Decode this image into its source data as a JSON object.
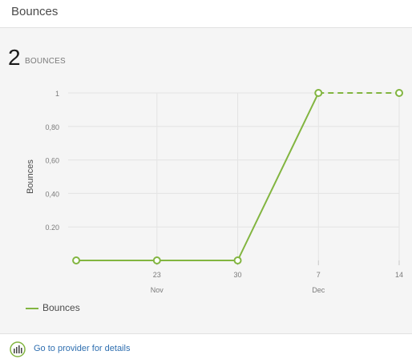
{
  "header": {
    "title": "Bounces"
  },
  "summary": {
    "value": "2",
    "label": "BOUNCES"
  },
  "chart_data": {
    "type": "line",
    "ylabel": "Bounces",
    "y_ticks": [
      "0.20",
      "0,40",
      "0,60",
      "0,80",
      "1"
    ],
    "y_tick_values": [
      0.2,
      0.4,
      0.6,
      0.8,
      1.0
    ],
    "ylim": [
      0,
      1
    ],
    "x_ticks": [
      {
        "label": "23",
        "month": "Nov",
        "value": 23
      },
      {
        "label": "30",
        "month": "",
        "value": 30
      },
      {
        "label": "7",
        "month": "Dec",
        "value": 37
      },
      {
        "label": "14",
        "month": "",
        "value": 44
      }
    ],
    "xlim": [
      15.3,
      44
    ],
    "series": [
      {
        "name": "Bounces",
        "color": "#82b540",
        "points": [
          {
            "x": 16,
            "y": 0
          },
          {
            "x": 23,
            "y": 0
          },
          {
            "x": 30,
            "y": 0
          },
          {
            "x": 37,
            "y": 1
          },
          {
            "x": 44,
            "y": 1,
            "projected": true
          }
        ]
      }
    ],
    "grid": true,
    "legend": "bottom-left"
  },
  "legend": {
    "label": "Bounces"
  },
  "footer": {
    "link_text": "Go to provider for details",
    "icon": "provider-chart-icon"
  }
}
